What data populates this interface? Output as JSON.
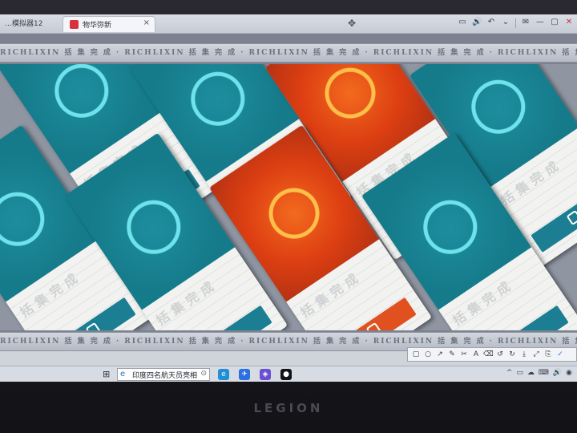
{
  "titlebar": {
    "prev_tab_label": "…模拟器12",
    "active_tab_title": "物华弥新",
    "close_glyph": "×",
    "move_glyph": "✥",
    "controls": [
      "▭",
      "🔊",
      "↶",
      "⌄",
      "✉",
      "—",
      "▢",
      "✕"
    ]
  },
  "game": {
    "band_text": "RICHLIXIN 括 集 完 成 · RICHLIXIN 括 集 完 成 · RICHLIXIN 括 集 完 成 · RICHLIXIN 括 集 完 成 · RICHLIXIN 括 集 完 成",
    "card_caption": "括集完成",
    "cards": [
      {
        "style": "teal",
        "mark": "teal"
      },
      {
        "style": "teal",
        "mark": "teal"
      },
      {
        "style": "teal",
        "mark": "teal"
      },
      {
        "style": "orange",
        "mark": "orange"
      },
      {
        "style": "orange",
        "mark": "orange"
      },
      {
        "style": "teal",
        "mark": "teal"
      },
      {
        "style": "teal",
        "mark": "teal"
      },
      {
        "style": "teal",
        "mark": "teal"
      }
    ],
    "colors": {
      "teal": "#157a8a",
      "orange": "#dd3f12",
      "accent": "#ffc04a"
    }
  },
  "draw_toolbar": {
    "tools": [
      "▢",
      "○",
      "↗",
      "✎",
      "✂",
      "A",
      "⌫",
      "↺",
      "↻",
      "⤓",
      "⤢",
      "⎘",
      "✓"
    ]
  },
  "taskbar": {
    "start_icon": "⊞",
    "search_text": "印度四名航天员亮相",
    "search_icon": "e",
    "camera_icon": "⊙",
    "apps": [
      {
        "name": "edge-icon",
        "glyph": "e",
        "color": "#1f8fd6"
      },
      {
        "name": "bird-icon",
        "glyph": "✈",
        "color": "#2b6fe0"
      },
      {
        "name": "game-icon",
        "glyph": "◈",
        "color": "#6b4fd2"
      },
      {
        "name": "penguin-icon",
        "glyph": "●",
        "color": "#111318"
      }
    ],
    "tray": [
      "^",
      "▭",
      "☁",
      "⌨",
      "🔊",
      "◉"
    ]
  },
  "brand": "LEGION"
}
